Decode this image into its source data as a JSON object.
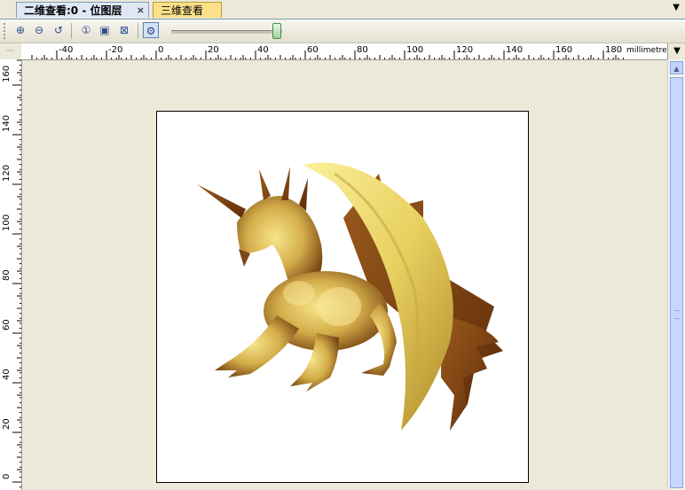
{
  "tabs": [
    {
      "label": "二维查看:0 - 位图层",
      "active": true
    },
    {
      "label": "三维查看",
      "active": false
    }
  ],
  "tab_close": "×",
  "tab_menu": "▼",
  "toolbar": {
    "buttons": [
      {
        "name": "zoom-in-icon",
        "glyph": "⊕"
      },
      {
        "name": "zoom-out-icon",
        "glyph": "⊖"
      },
      {
        "name": "zoom-reset-icon",
        "glyph": "↺"
      },
      {
        "name": "zoom-actual-icon",
        "glyph": "①"
      },
      {
        "name": "zoom-fit-icon",
        "glyph": "▣"
      },
      {
        "name": "zoom-area-icon",
        "glyph": "⊠"
      },
      {
        "name": "render-settings-icon",
        "glyph": "⚙"
      }
    ],
    "slider_value": 1.0
  },
  "ruler": {
    "unit": "millimetres",
    "h_labels": [
      "-40",
      "-20",
      "0",
      "20",
      "40",
      "60",
      "80",
      "100",
      "120",
      "140",
      "160",
      "180"
    ],
    "v_labels": [
      "160",
      "140",
      "120",
      "100",
      "80",
      "60",
      "40",
      "20",
      "0"
    ]
  },
  "colors": {
    "accent": "#7f9db9",
    "tab_inactive": "#fde18a",
    "canvas_bg": "#ece9d8"
  }
}
